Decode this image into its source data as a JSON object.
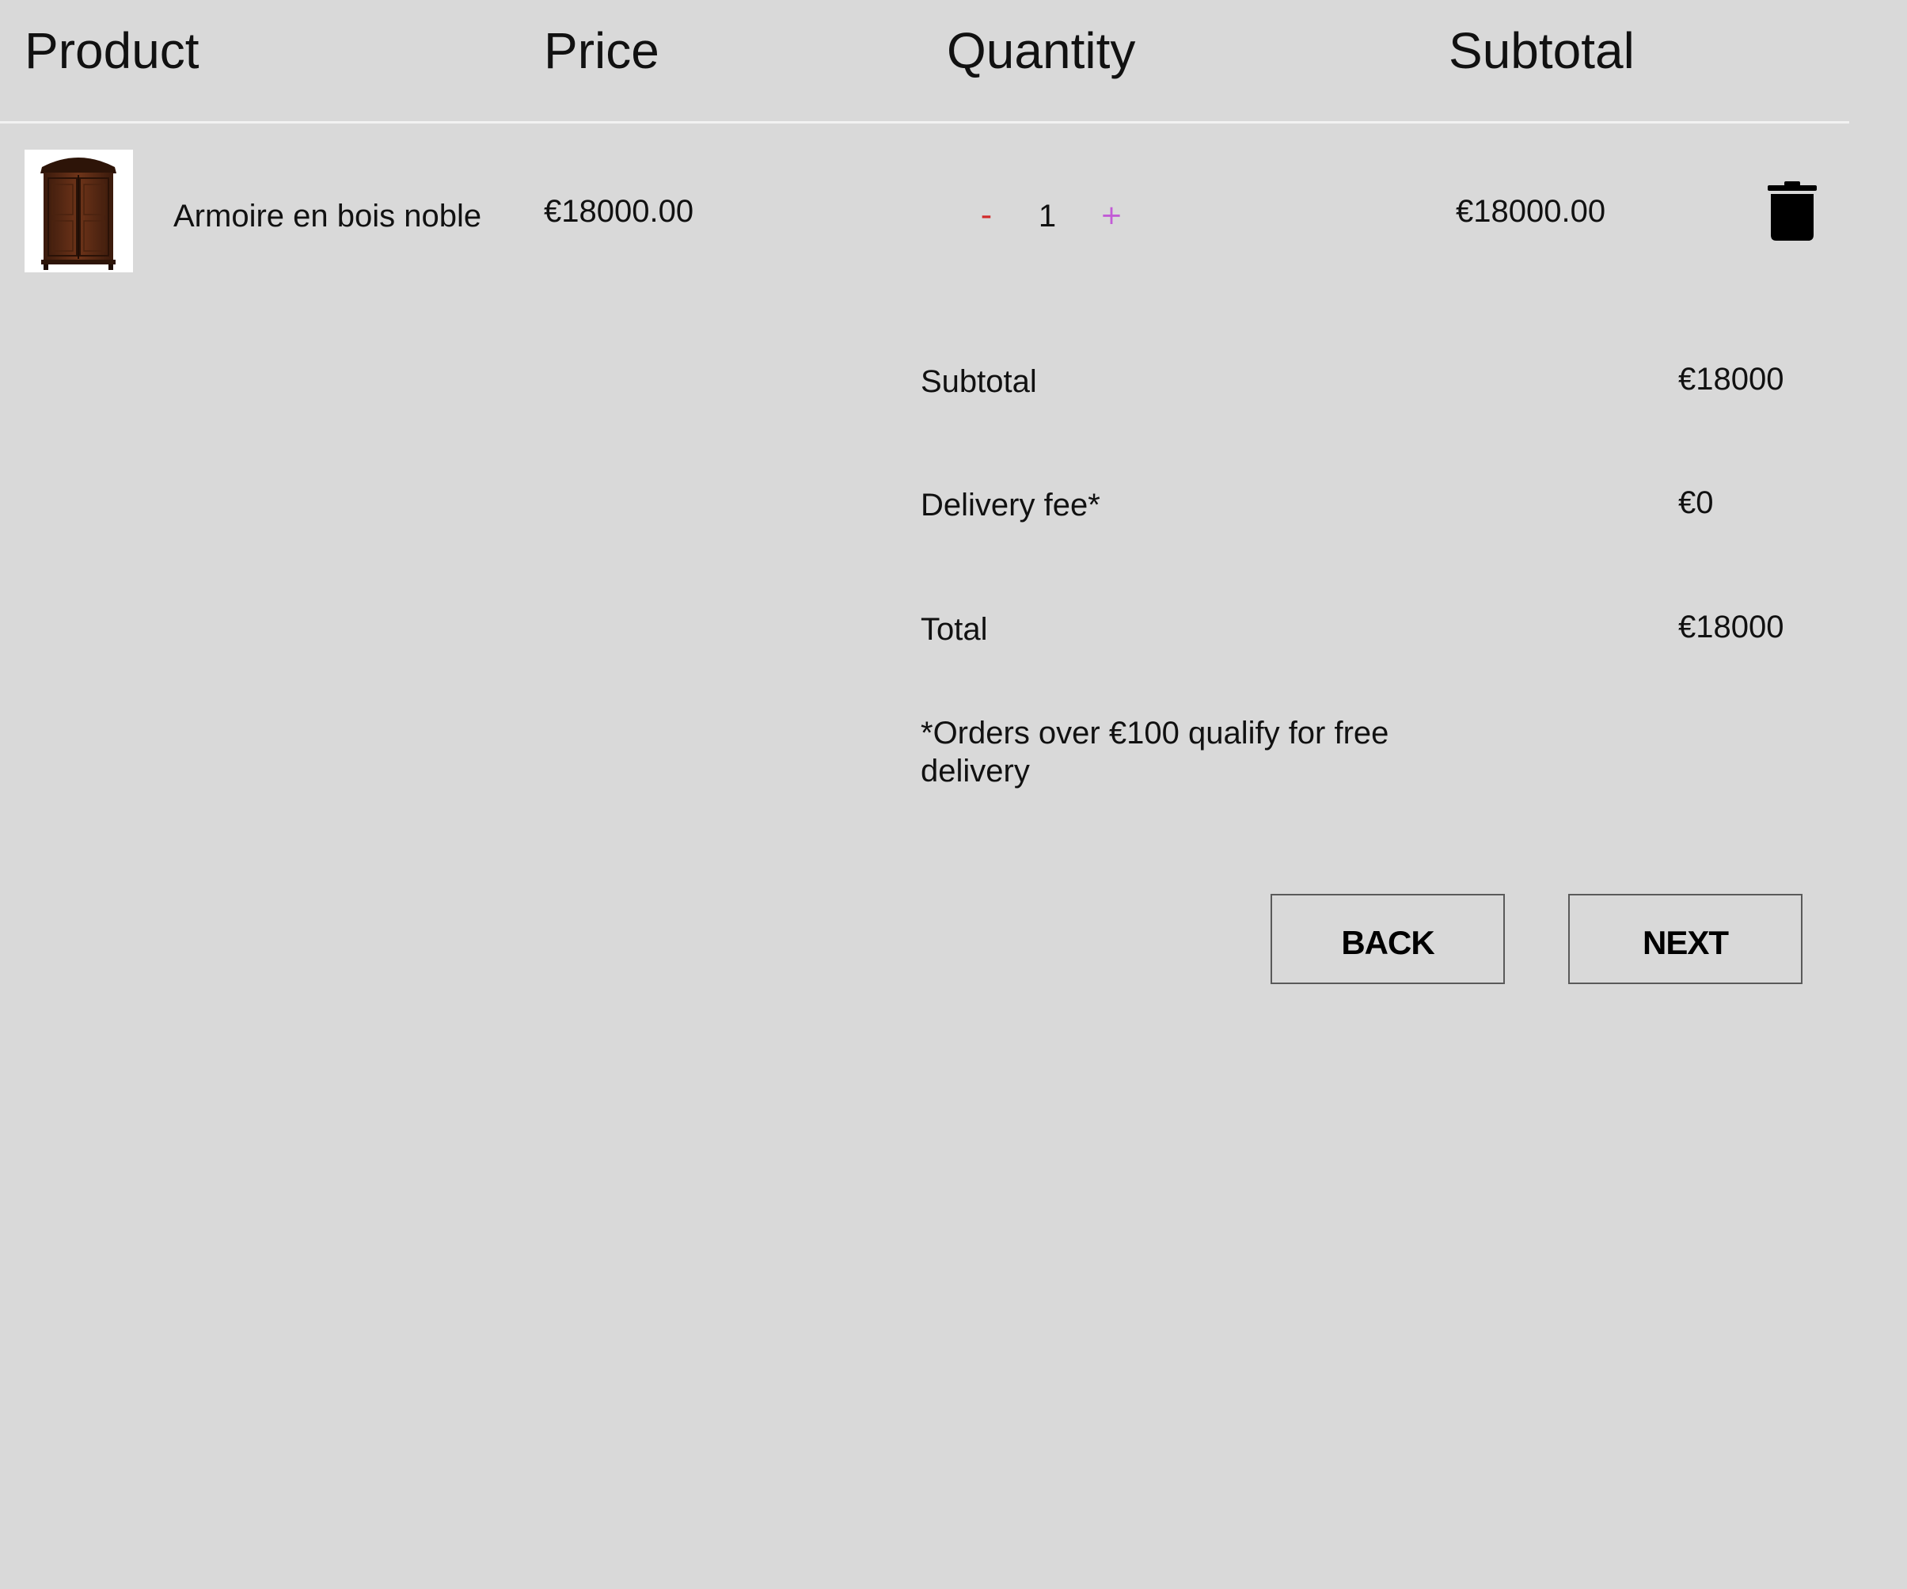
{
  "table": {
    "headers": [
      "Product",
      "Price",
      "Quantity",
      "Subtotal"
    ],
    "rows": [
      {
        "product_name": "Armoire en bois noble",
        "price": "€18000.00",
        "quantity": "1",
        "decrement_label": "-",
        "increment_label": "+",
        "subtotal": "€18000.00",
        "image_icon": "wooden-armoire-image",
        "delete_icon": "trash-icon"
      }
    ]
  },
  "summary": {
    "subtotal_label": "Subtotal",
    "subtotal_value": "€18000",
    "delivery_label": "Delivery fee*",
    "delivery_value": "€0",
    "total_label": "Total",
    "total_value": "€18000",
    "note": "*Orders over €100 qualify for free delivery"
  },
  "actions": {
    "back_label": "BACK",
    "next_label": "NEXT"
  },
  "colors": {
    "background": "#d9d9d9",
    "divider": "#f2f2f2",
    "decrement": "#d12a2a",
    "increment": "#c25bd6"
  }
}
